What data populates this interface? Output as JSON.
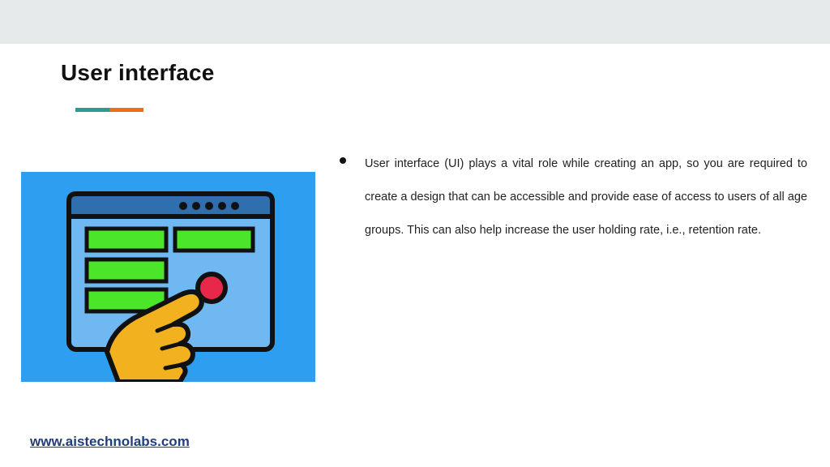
{
  "slide": {
    "title": "User interface",
    "accent_colors": [
      "#2a9d8f",
      "#e76f1e"
    ],
    "bullets": [
      "User interface (UI) plays a vital role while creating an app, so you are required to create a design that can be accessible and provide ease of access to users of all age groups. This can also help increase the user holding rate, i.e., retention rate."
    ],
    "illustration": {
      "icon": "ui-touch-screen-icon",
      "background_color": "#2d9ef0"
    }
  },
  "footer": {
    "link": "www.aistechnolabs.com"
  }
}
